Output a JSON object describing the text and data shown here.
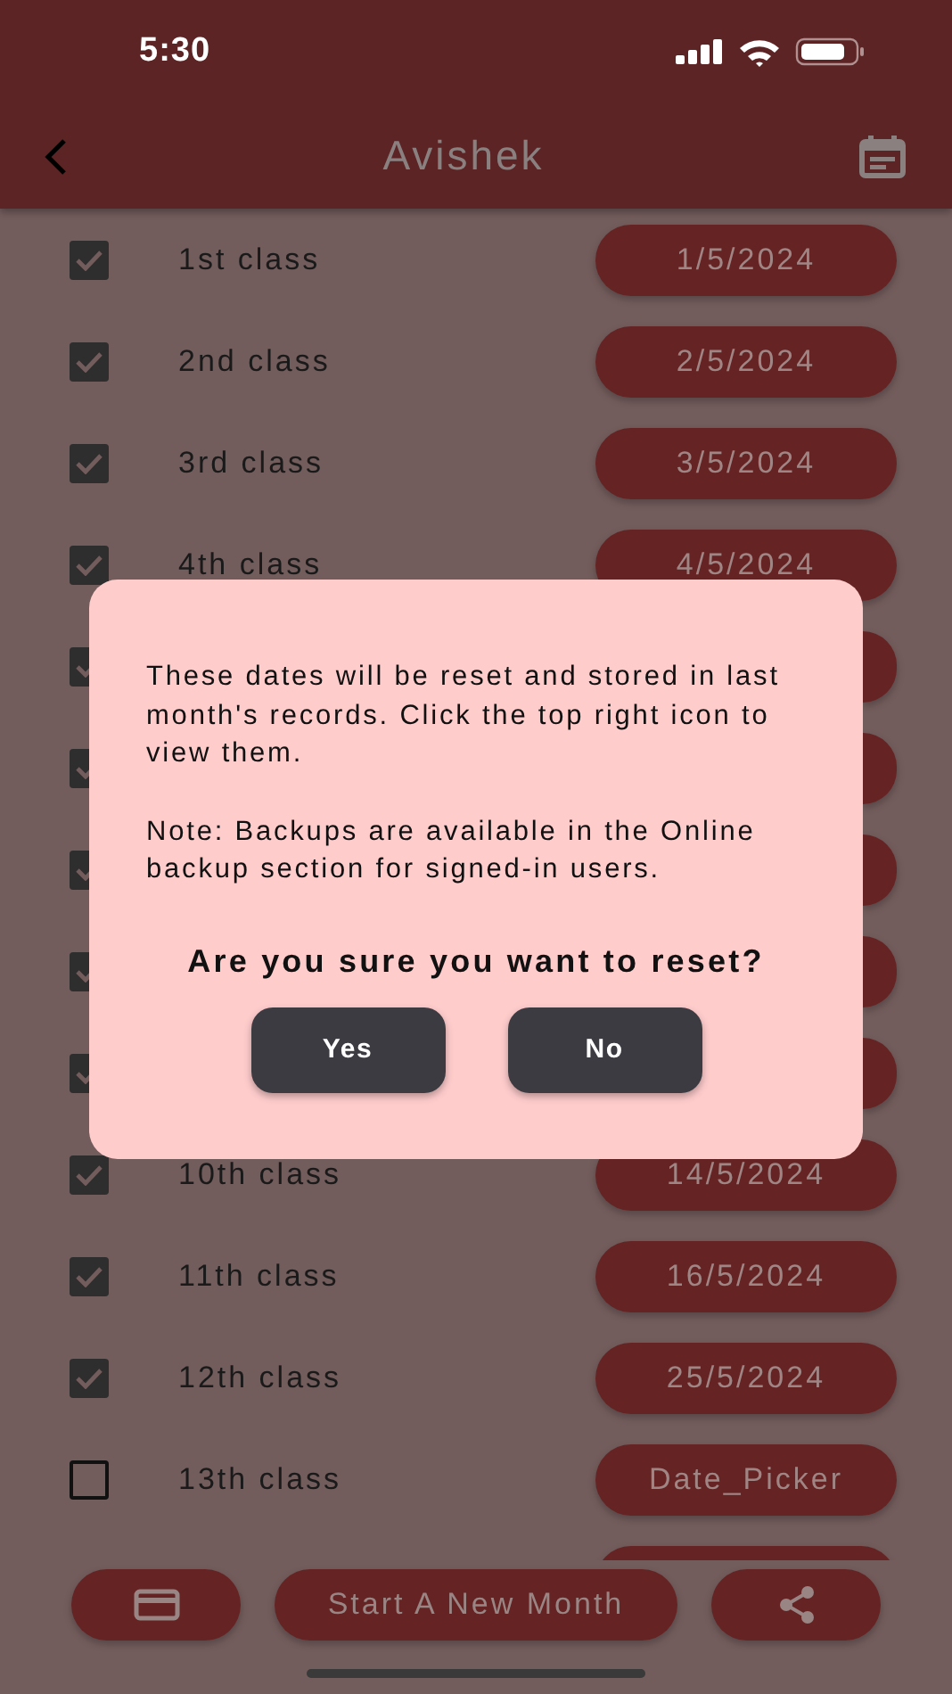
{
  "status_bar": {
    "time": "5:30"
  },
  "header": {
    "title": "Avishek"
  },
  "classes": [
    {
      "label": "1st class",
      "date": "1/5/2024",
      "checked": true
    },
    {
      "label": "2nd class",
      "date": "2/5/2024",
      "checked": true
    },
    {
      "label": "3rd class",
      "date": "3/5/2024",
      "checked": true
    },
    {
      "label": "4th class",
      "date": "4/5/2024",
      "checked": true
    },
    {
      "checked": true
    },
    {
      "checked": true
    },
    {
      "checked": true
    },
    {
      "checked": true
    },
    {
      "checked": true
    },
    {
      "label": "10th class",
      "date": "14/5/2024",
      "checked": true
    },
    {
      "label": "11th class",
      "date": "16/5/2024",
      "checked": true
    },
    {
      "label": "12th class",
      "date": "25/5/2024",
      "checked": true
    },
    {
      "label": "13th class",
      "date": "Date_Picker",
      "checked": false
    }
  ],
  "dialog": {
    "paragraphs": [
      "These dates will be reset and stored in last month's records. Click the top right icon to view them.",
      "Note: Backups are available in the Online backup section for signed-in users."
    ],
    "question": "Are you sure you want to reset?",
    "buttons": [
      "Yes",
      "No"
    ]
  },
  "bottom_bar": {
    "button": "Start A New Month"
  }
}
